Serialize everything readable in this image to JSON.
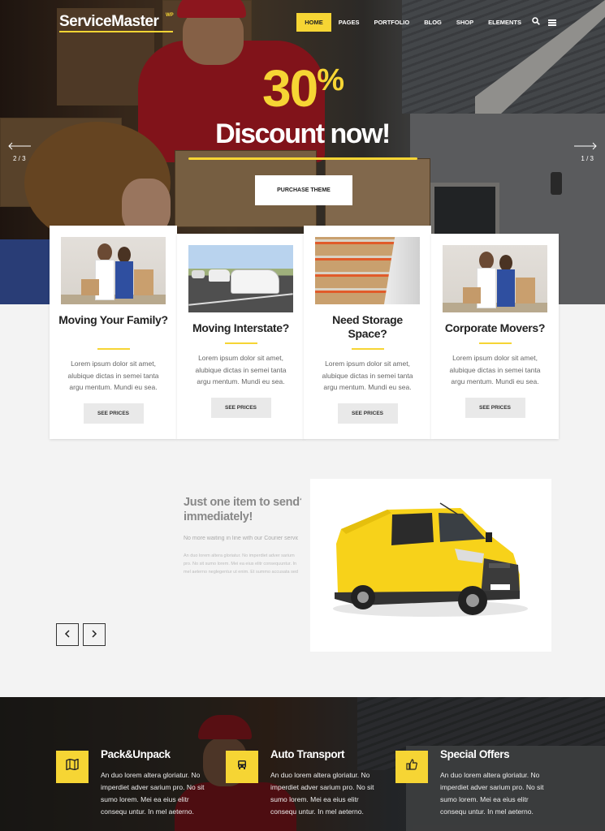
{
  "header": {
    "logo": "ServiceMaster",
    "logo_badge": "WP",
    "nav": [
      "HOME",
      "PAGES",
      "PORTFOLIO",
      "BLOG",
      "SHOP",
      "ELEMENTS"
    ],
    "active_nav": "HOME"
  },
  "hero": {
    "big_number": "30",
    "percent": "%",
    "headline": "Discount now!",
    "button": "PURCHASE THEME",
    "slide_left": "2 / 3",
    "slide_right": "1 / 3"
  },
  "cards": [
    {
      "title": "Moving Your Family?",
      "text": "Lorem ipsum dolor sit amet, alubique dictas in semei tanta argu mentum. Mundi eu sea.",
      "button": "SEE PRICES"
    },
    {
      "title": "Moving Interstate?",
      "text": "Lorem ipsum dolor sit amet, alubique dictas in semei tanta argu mentum. Mundi eu sea.",
      "button": "SEE PRICES"
    },
    {
      "title": "Need Storage Space?",
      "text": "Lorem ipsum dolor sit amet, alubique dictas in semei tanta argu mentum. Mundi eu sea.",
      "button": "SEE PRICES"
    },
    {
      "title": "Corporate Movers?",
      "text": "Lorem ipsum dolor sit amet, alubique dictas in semei tanta argu mentum. Mundi eu sea.",
      "button": "SEE PRICES"
    }
  ],
  "courier": {
    "title_line1": "Just one item to send?",
    "title_line2": "immediately!",
    "subtitle": "No more waiting in line with our Courier service",
    "body": "An duo lorem altera gloriatur. No imperdiet adver sarium pro. No sit sumo lorem. Mei ea eius elitr consequuntur. In mel aeterno neglegentur ut enim. Et summo accusata sed duo unique."
  },
  "features": [
    {
      "icon": "map-icon",
      "title": "Pack&Unpack",
      "text": "An duo lorem altera gloriatur. No imperdiet adver sarium pro. No sit sumo lorem. Mei ea eius elitr consequ untur. In mel aeterno."
    },
    {
      "icon": "car-icon",
      "title": "Auto Transport",
      "text": "An duo lorem altera gloriatur. No imperdiet adver sarium pro. No sit sumo lorem. Mei ea eius elitr consequ untur. In mel aeterno."
    },
    {
      "icon": "thumbs-up-icon",
      "title": "Special Offers",
      "text": "An duo lorem altera gloriatur. No imperdiet adver sarium pro. No sit sumo lorem. Mei ea eius elitr consequ untur. In mel aeterno."
    }
  ],
  "colors": {
    "accent": "#f6d534",
    "dark": "#222222",
    "background": "#f3f3f3"
  }
}
